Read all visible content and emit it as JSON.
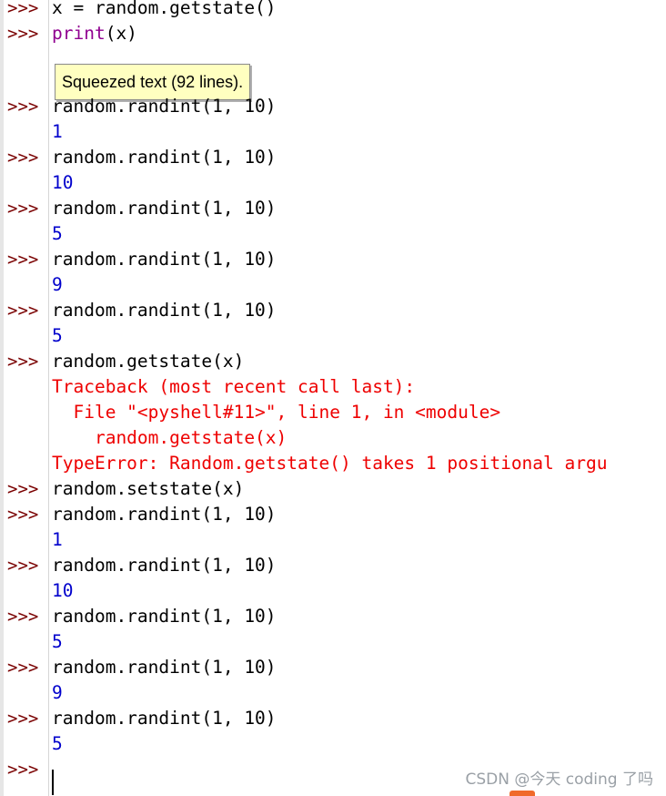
{
  "prompt": ">>>",
  "lines": [
    {
      "kind": "input",
      "text": "x = random.getstate()"
    },
    {
      "kind": "input_print",
      "fn": "print",
      "rest": "(x)"
    },
    {
      "kind": "squeezed",
      "text": "Squeezed text (92 lines)."
    },
    {
      "kind": "input",
      "text": "random.randint(1, 10)"
    },
    {
      "kind": "output",
      "text": "1"
    },
    {
      "kind": "input",
      "text": "random.randint(1, 10)"
    },
    {
      "kind": "output",
      "text": "10"
    },
    {
      "kind": "input",
      "text": "random.randint(1, 10)"
    },
    {
      "kind": "output",
      "text": "5"
    },
    {
      "kind": "input",
      "text": "random.randint(1, 10)"
    },
    {
      "kind": "output",
      "text": "9"
    },
    {
      "kind": "input",
      "text": "random.randint(1, 10)"
    },
    {
      "kind": "output",
      "text": "5"
    },
    {
      "kind": "input",
      "text": "random.getstate(x)"
    },
    {
      "kind": "error",
      "text": "Traceback (most recent call last):"
    },
    {
      "kind": "error",
      "text": "  File \"<pyshell#11>\", line 1, in <module>"
    },
    {
      "kind": "error",
      "text": "    random.getstate(x)"
    },
    {
      "kind": "error",
      "text": "TypeError: Random.getstate() takes 1 positional argu"
    },
    {
      "kind": "input",
      "text": "random.setstate(x)"
    },
    {
      "kind": "input",
      "text": "random.randint(1, 10)"
    },
    {
      "kind": "output",
      "text": "1"
    },
    {
      "kind": "input",
      "text": "random.randint(1, 10)"
    },
    {
      "kind": "output",
      "text": "10"
    },
    {
      "kind": "input",
      "text": "random.randint(1, 10)"
    },
    {
      "kind": "output",
      "text": "5"
    },
    {
      "kind": "input",
      "text": "random.randint(1, 10)"
    },
    {
      "kind": "output",
      "text": "9"
    },
    {
      "kind": "input",
      "text": "random.randint(1, 10)"
    },
    {
      "kind": "output",
      "text": "5"
    },
    {
      "kind": "input",
      "text": ""
    }
  ],
  "watermark": "CSDN @今天 coding 了吗",
  "colors": {
    "prompt": "#7a0000",
    "output": "#0000cc",
    "error": "#ee0000",
    "builtin": "#900090",
    "squeezed_bg": "#ffffc0"
  }
}
